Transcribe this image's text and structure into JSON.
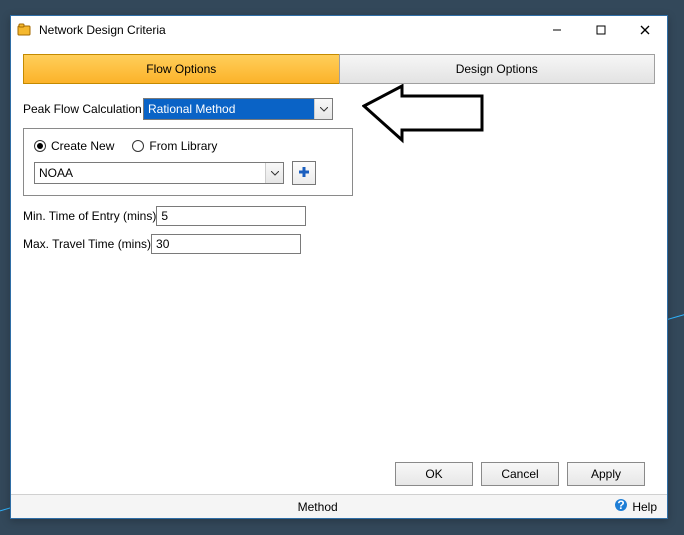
{
  "window": {
    "title": "Network Design Criteria",
    "minimize": "—",
    "maximize": "☐",
    "close": "✕"
  },
  "tabs": {
    "flow": "Flow Options",
    "design": "Design Options"
  },
  "peak": {
    "label": "Peak Flow Calculation",
    "value": "Rational Method"
  },
  "source": {
    "create_new": "Create New",
    "from_library": "From Library",
    "library_value": "NOAA"
  },
  "min_entry": {
    "label": "Min. Time of Entry (mins)",
    "value": "5"
  },
  "max_travel": {
    "label": "Max. Travel Time (mins)",
    "value": "30"
  },
  "buttons": {
    "ok": "OK",
    "cancel": "Cancel",
    "apply": "Apply"
  },
  "status": {
    "center": "Method",
    "help": "Help"
  }
}
